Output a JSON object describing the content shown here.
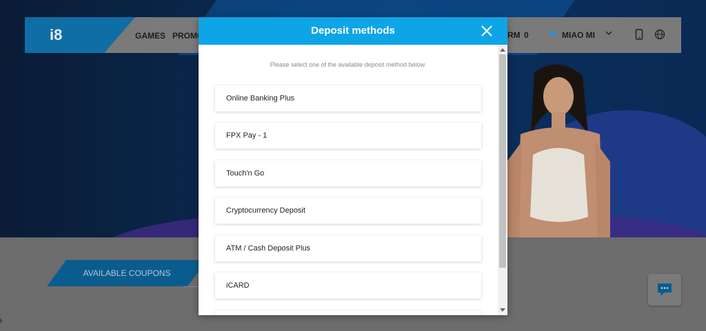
{
  "background_page": {
    "logo": "i8",
    "nav": {
      "games": "GAMES",
      "promo": "PROMO",
      "rm": "RM",
      "balance": "0",
      "username": "MIAO MI"
    },
    "coupons_label": "AVAILABLE COUPONS"
  },
  "modal": {
    "title": "Deposit methods",
    "subtitle": "Please select one of the available deposit method below.",
    "methods": [
      "Online Banking Plus",
      "FPX Pay - 1",
      "Touch'n Go",
      "Cryptocurrency Deposit",
      "ATM / Cash Deposit Plus",
      "iCARD"
    ]
  },
  "colors": {
    "modal_header": "#0ea5e6",
    "brand_blue": "#0f6ea5",
    "overlay": "#6e6e6e"
  },
  "icons": [
    "close-icon",
    "diamond-icon",
    "chevron-down-icon",
    "phone-icon",
    "globe-icon",
    "chat-icon"
  ]
}
